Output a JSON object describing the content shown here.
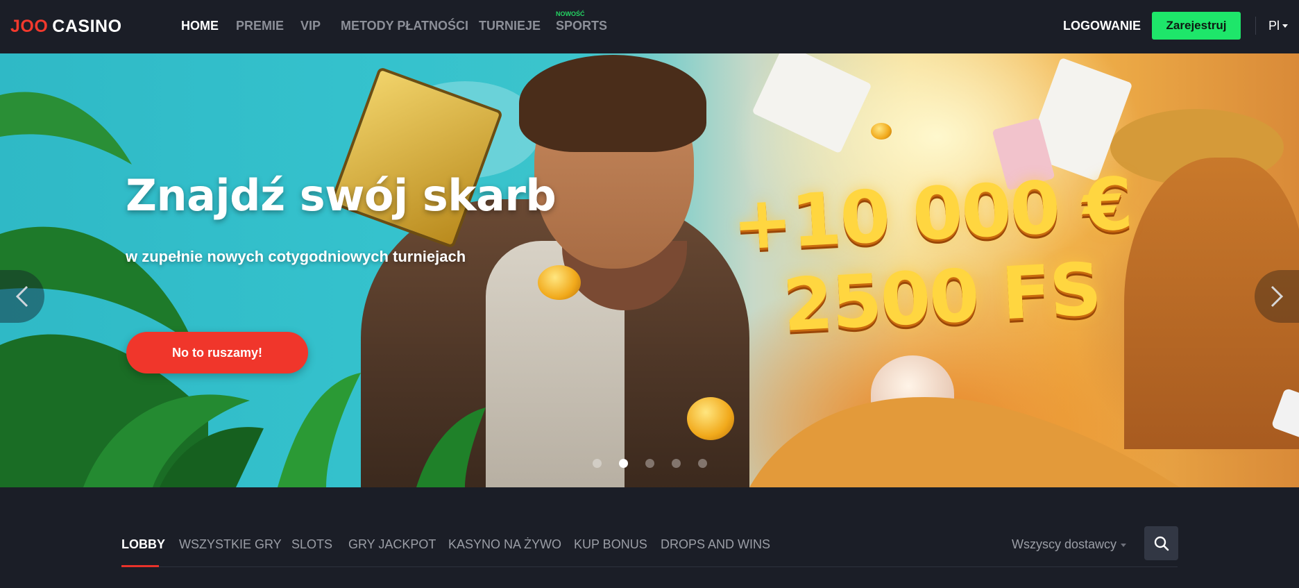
{
  "header": {
    "logo": {
      "part1": "JOO",
      "part2": "CASINO"
    },
    "nav": [
      {
        "label": "HOME",
        "active": true
      },
      {
        "label": "PREMIE",
        "active": false
      },
      {
        "label": "VIP",
        "active": false
      },
      {
        "label": "METODY PŁATNOŚCI",
        "active": false
      },
      {
        "label": "TURNIEJE",
        "active": false
      },
      {
        "label": "SPORTS",
        "active": false,
        "badge": "NOWOŚĆ"
      }
    ],
    "login_label": "LOGOWANIE",
    "register_label": "Zarejestruj",
    "language": "Pl"
  },
  "hero": {
    "title": "Znajdź swój skarb",
    "subtitle": "w zupełnie nowych cotygodniowych turniejach",
    "cta_label": "No to ruszamy!",
    "bonus_line1": "+10 000 €",
    "bonus_line2": "2500 FS",
    "slides_count": 5,
    "active_slide": 2
  },
  "lobby": {
    "tabs": [
      {
        "label": "LOBBY",
        "active": true
      },
      {
        "label": "WSZYSTKIE GRY",
        "active": false
      },
      {
        "label": "SLOTS",
        "active": false
      },
      {
        "label": "GRY JACKPOT",
        "active": false
      },
      {
        "label": "KASYNO NA ŻYWO",
        "active": false
      },
      {
        "label": "KUP BONUS",
        "active": false
      },
      {
        "label": "DROPS AND WINS",
        "active": false
      }
    ],
    "providers_label": "Wszyscy dostawcy"
  },
  "colors": {
    "brand_red": "#f2392d",
    "register_green": "#1ee66a",
    "new_badge_green": "#24d463",
    "background": "#1b1e27"
  },
  "icons": {
    "search": "search-icon",
    "arrow_left": "chevron-left-icon",
    "arrow_right": "chevron-right-icon",
    "dropdown": "chevron-down-icon"
  }
}
